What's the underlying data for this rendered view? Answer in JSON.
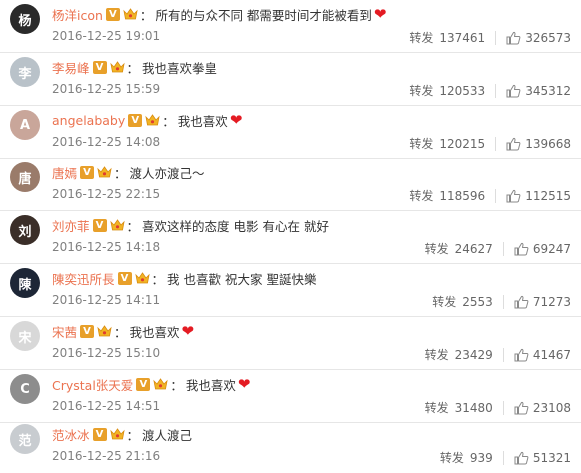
{
  "forward_label": "转发",
  "comments": [
    {
      "name": "杨洋icon",
      "content": "所有的与众不同 都需要时间才能被看到",
      "heart": true,
      "heart_char": "❤",
      "date": "2016-12-25 19:01",
      "forward": "137461",
      "like": "326573",
      "avatar_color": "#2a2a2a",
      "avatar_text": "杨"
    },
    {
      "name": "李易峰",
      "content": "我也喜欢拳皇",
      "heart": false,
      "heart_char": "",
      "date": "2016-12-25 15:59",
      "forward": "120533",
      "like": "345312",
      "avatar_color": "#b9c2c9",
      "avatar_text": "李"
    },
    {
      "name": "angelababy",
      "content": "我也喜欢",
      "heart": true,
      "heart_char": "❤",
      "date": "2016-12-25 14:08",
      "forward": "120215",
      "like": "139668",
      "avatar_color": "#c9a69a",
      "avatar_text": "A"
    },
    {
      "name": "唐嫣",
      "content": "渡人亦渡己～",
      "heart": false,
      "heart_char": "",
      "date": "2016-12-25 22:15",
      "forward": "118596",
      "like": "112515",
      "avatar_color": "#9a7b6a",
      "avatar_text": "唐"
    },
    {
      "name": "刘亦菲",
      "content": "喜欢这样的态度 电影 有心在 就好",
      "heart": false,
      "heart_char": "",
      "date": "2016-12-25 14:18",
      "forward": "24627",
      "like": "69247",
      "avatar_color": "#3a2e28",
      "avatar_text": "刘"
    },
    {
      "name": "陳奕迅所長",
      "content": "我  也喜歡 祝大家 聖誕快樂",
      "heart": false,
      "heart_char": "",
      "date": "2016-12-25 14:11",
      "forward": "2553",
      "like": "71273",
      "avatar_color": "#1d2636",
      "avatar_text": "陳"
    },
    {
      "name": "宋茜",
      "content": "我也喜欢",
      "heart": true,
      "heart_char": "❤",
      "date": "2016-12-25 15:10",
      "forward": "23429",
      "like": "41467",
      "avatar_color": "#d8d8d8",
      "avatar_text": "宋"
    },
    {
      "name": "Crystal张天爱",
      "content": "我也喜欢",
      "heart": true,
      "heart_char": "❤",
      "date": "2016-12-25 14:51",
      "forward": "31480",
      "like": "23108",
      "avatar_color": "#8d8d8d",
      "avatar_text": "C"
    },
    {
      "name": "范冰冰",
      "content": "渡人渡己",
      "heart": false,
      "heart_char": "",
      "date": "2016-12-25 21:16",
      "forward": "939",
      "like": "51321",
      "avatar_color": "#c8ccd0",
      "avatar_text": "范"
    }
  ],
  "colors": {
    "name": "#eb7350",
    "heart": "#e41b23",
    "vbadge": "#e8a02a"
  }
}
